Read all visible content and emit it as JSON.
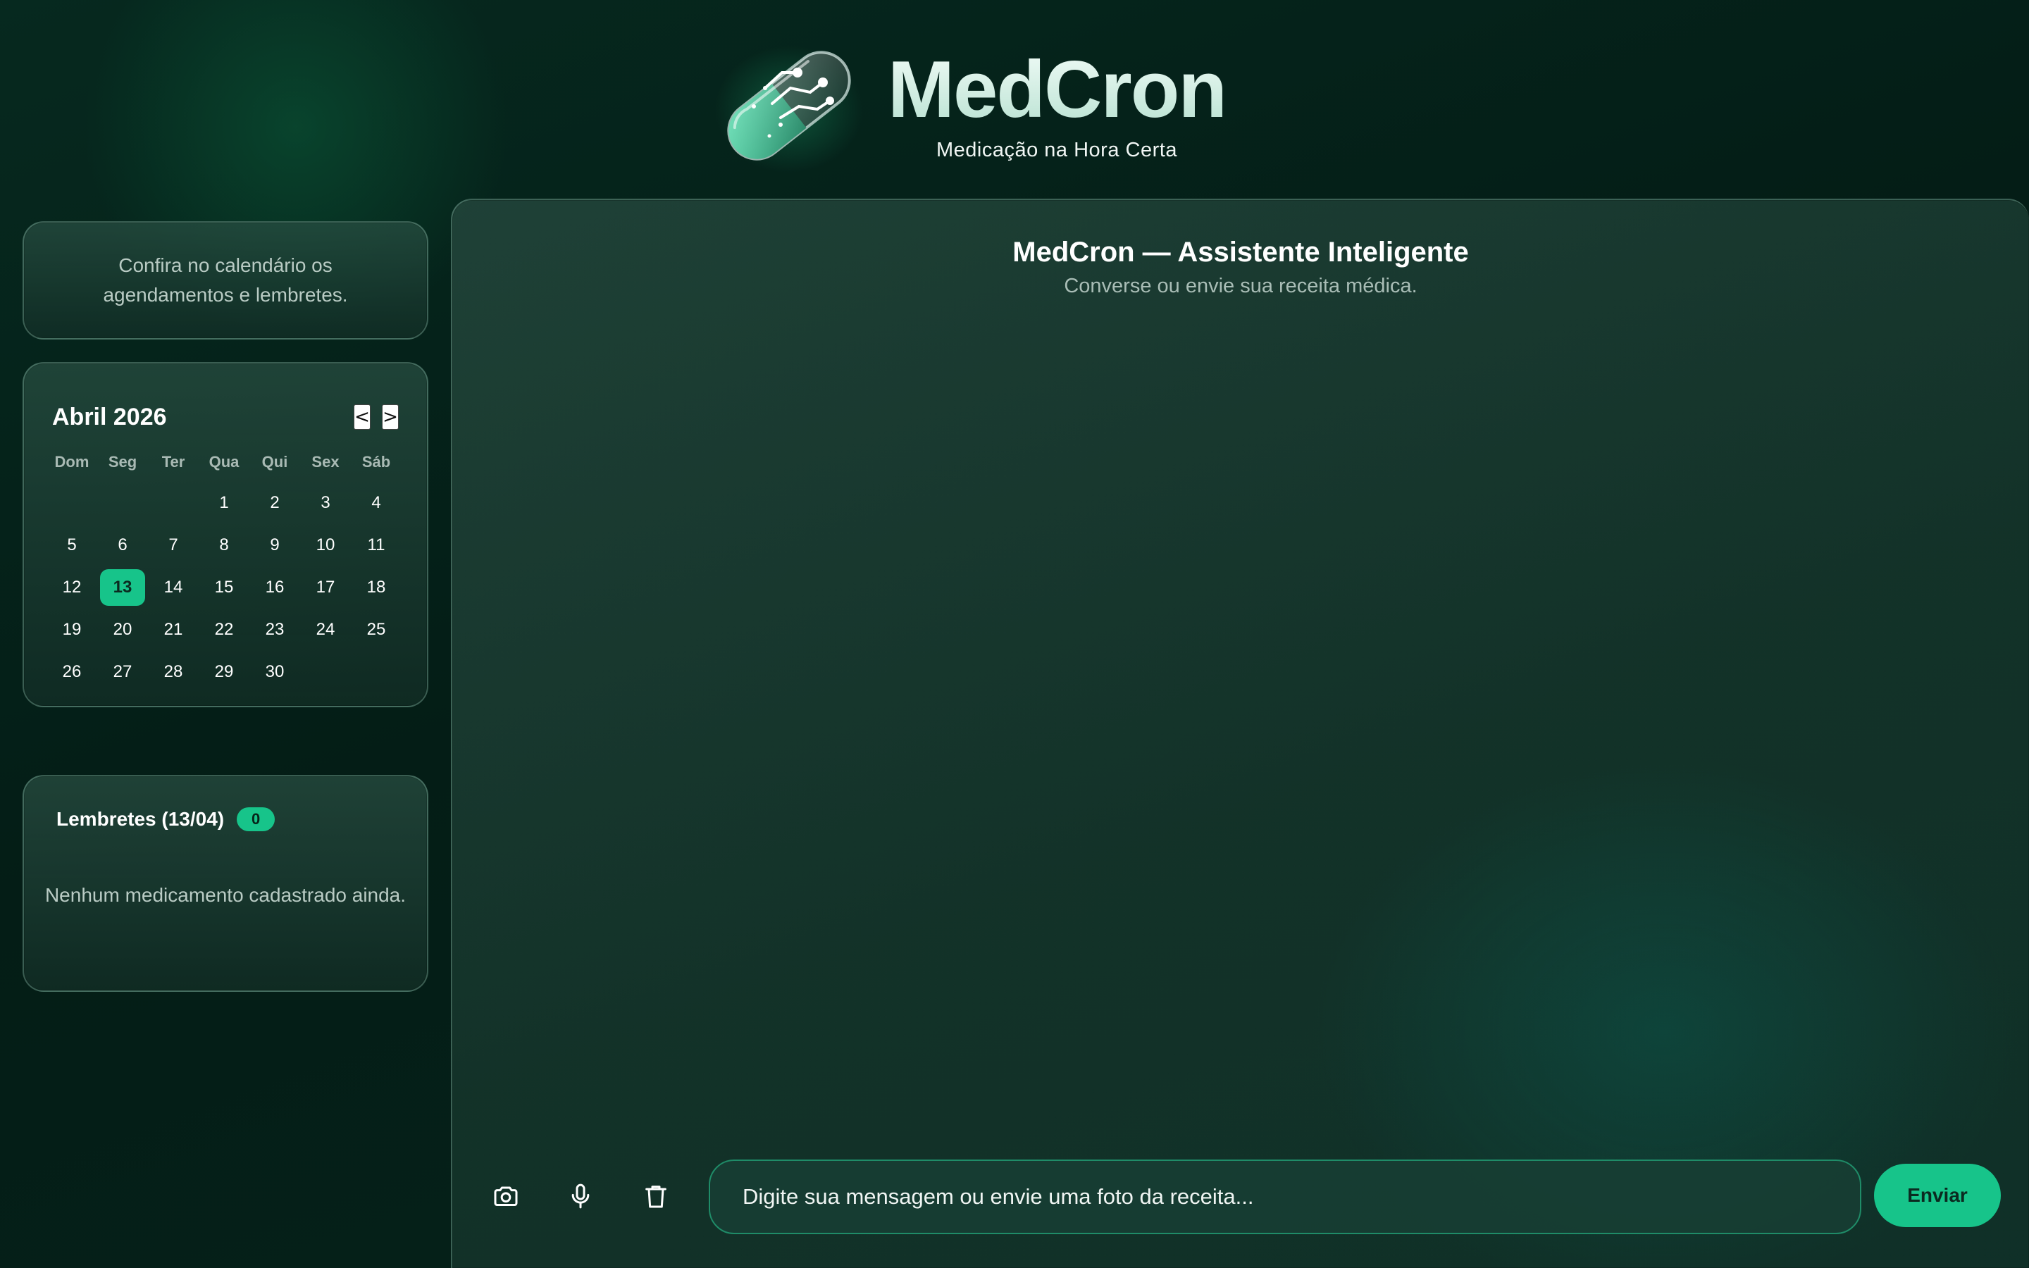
{
  "header": {
    "brand_name": "MedCron",
    "tagline": "Medicação na Hora Certa",
    "logo_icon": "pill-capsule-circuit-icon"
  },
  "colors": {
    "accent": "#17c48a",
    "background": "#052119",
    "card": "#1c3e34",
    "muted_text": "#b9cbc4"
  },
  "info": {
    "text": "Confira no calendário os agendamentos e lembretes."
  },
  "calendar": {
    "title": "Abril 2026",
    "prev_label": "<",
    "next_label": ">",
    "weekdays": [
      "Dom",
      "Seg",
      "Ter",
      "Qua",
      "Qui",
      "Sex",
      "Sáb"
    ],
    "leading_blanks": 3,
    "days_in_month": 30,
    "selected_day": 13
  },
  "reminders": {
    "title": "Lembretes (13/04)",
    "count": "0",
    "empty_text": "Nenhum medicamento cadastrado ainda."
  },
  "chat": {
    "title": "MedCron — Assistente Inteligente",
    "subtitle": "Converse ou envie sua receita médica.",
    "messages": [],
    "input_placeholder": "Digite sua mensagem ou envie uma foto da receita...",
    "send_label": "Enviar",
    "tools": [
      "camera-icon",
      "microphone-icon",
      "trash-icon"
    ]
  }
}
